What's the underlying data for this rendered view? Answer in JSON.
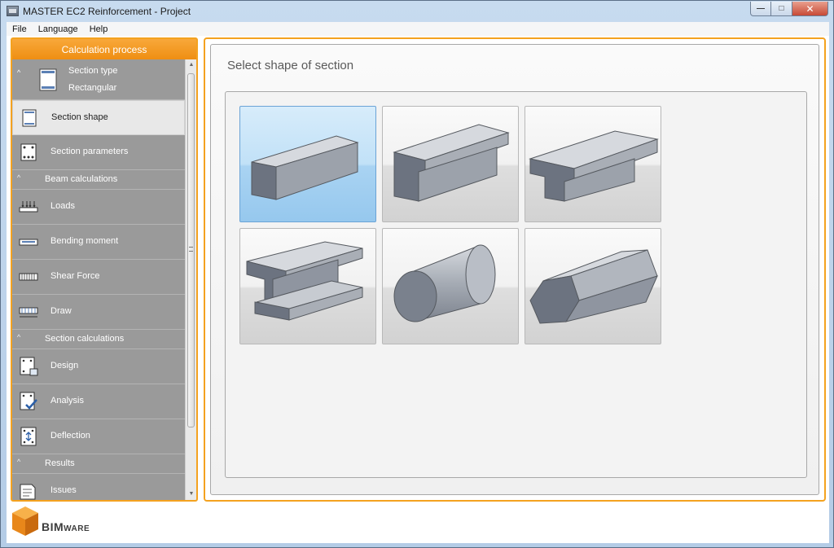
{
  "window": {
    "title": "MASTER EC2 Reinforcement - Project",
    "controls": {
      "minimize": "—",
      "maximize": "□",
      "close": "✕"
    }
  },
  "menu": [
    "File",
    "Language",
    "Help"
  ],
  "left_panel": {
    "header": "Calculation process",
    "section_type": {
      "label": "Section type",
      "value": "Rectangular"
    },
    "items_group1": [
      "Section shape",
      "Section parameters"
    ],
    "groups": {
      "beam": "Beam calculations",
      "section": "Section calculations",
      "results": "Results"
    },
    "beam_items": [
      "Loads",
      "Bending moment",
      "Shear Force",
      "Draw"
    ],
    "section_items": [
      "Design",
      "Analysis",
      "Deflection"
    ],
    "result_items": [
      "Issues"
    ],
    "selected": "Section shape"
  },
  "logo": {
    "brand": "BIM",
    "brand_small": "WARE"
  },
  "main": {
    "title": "Select shape of section",
    "shapes": [
      "rectangular",
      "l-shape",
      "t-shape",
      "i-beam",
      "circular",
      "polygonal"
    ],
    "selected_shape": "rectangular"
  },
  "colors": {
    "accent": "#f4a21f",
    "panel_gray": "#9a9a9a",
    "selected_tile": "#a9d3f2"
  }
}
